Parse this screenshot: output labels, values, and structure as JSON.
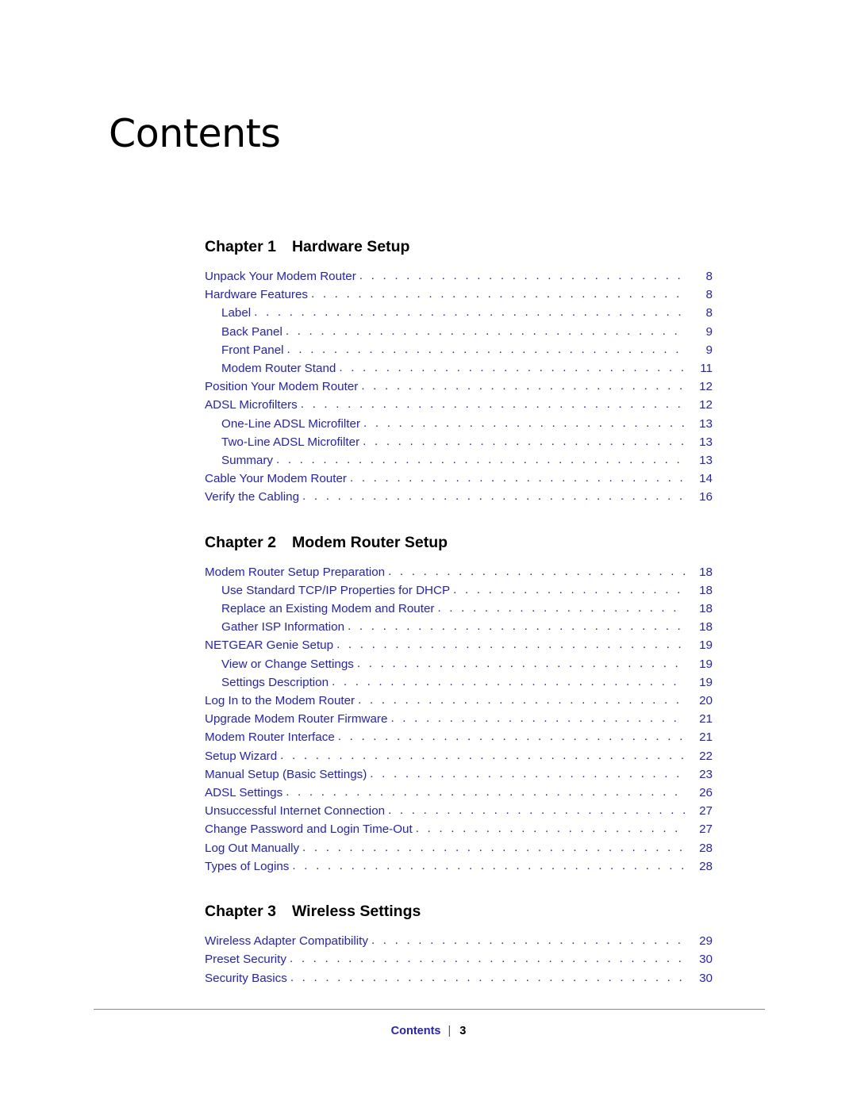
{
  "page": {
    "title": "Contents",
    "footer": {
      "title": "Contents",
      "separator": "|",
      "page_number": "3"
    }
  },
  "toc": {
    "groups": [
      {
        "chapter_label": "Chapter 1",
        "chapter_title": "Hardware Setup",
        "entries": [
          {
            "label": "Unpack Your Modem Router",
            "page": "8",
            "level": 1
          },
          {
            "label": "Hardware Features",
            "page": "8",
            "level": 1
          },
          {
            "label": "Label",
            "page": "8",
            "level": 2
          },
          {
            "label": "Back Panel",
            "page": "9",
            "level": 2
          },
          {
            "label": "Front Panel",
            "page": "9",
            "level": 2
          },
          {
            "label": "Modem Router Stand",
            "page": "11",
            "level": 2
          },
          {
            "label": "Position Your Modem Router",
            "page": "12",
            "level": 1
          },
          {
            "label": "ADSL Microfilters",
            "page": "12",
            "level": 1
          },
          {
            "label": "One-Line ADSL Microfilter",
            "page": "13",
            "level": 2
          },
          {
            "label": "Two-Line ADSL Microfilter",
            "page": "13",
            "level": 2
          },
          {
            "label": "Summary",
            "page": "13",
            "level": 2
          },
          {
            "label": "Cable Your Modem Router",
            "page": "14",
            "level": 1
          },
          {
            "label": "Verify the Cabling",
            "page": "16",
            "level": 1
          }
        ]
      },
      {
        "chapter_label": "Chapter 2",
        "chapter_title": "Modem Router Setup",
        "entries": [
          {
            "label": "Modem Router Setup Preparation",
            "page": "18",
            "level": 1
          },
          {
            "label": "Use Standard TCP/IP Properties for DHCP",
            "page": "18",
            "level": 2
          },
          {
            "label": "Replace an Existing Modem and Router",
            "page": "18",
            "level": 2
          },
          {
            "label": "Gather ISP Information",
            "page": "18",
            "level": 2
          },
          {
            "label": "NETGEAR Genie Setup",
            "page": "19",
            "level": 1
          },
          {
            "label": "View or Change Settings",
            "page": "19",
            "level": 2
          },
          {
            "label": "Settings Description",
            "page": "19",
            "level": 2
          },
          {
            "label": "Log In to the Modem Router",
            "page": "20",
            "level": 1
          },
          {
            "label": "Upgrade Modem Router Firmware",
            "page": "21",
            "level": 1
          },
          {
            "label": "Modem Router Interface",
            "page": "21",
            "level": 1
          },
          {
            "label": "Setup Wizard",
            "page": "22",
            "level": 1
          },
          {
            "label": "Manual Setup (Basic Settings)",
            "page": "23",
            "level": 1
          },
          {
            "label": "ADSL Settings",
            "page": "26",
            "level": 1
          },
          {
            "label": "Unsuccessful Internet Connection",
            "page": "27",
            "level": 1
          },
          {
            "label": "Change Password and Login Time-Out",
            "page": "27",
            "level": 1
          },
          {
            "label": "Log Out Manually",
            "page": "28",
            "level": 1
          },
          {
            "label": "Types of Logins",
            "page": "28",
            "level": 1
          }
        ]
      },
      {
        "chapter_label": "Chapter 3",
        "chapter_title": "Wireless Settings",
        "entries": [
          {
            "label": "Wireless Adapter Compatibility",
            "page": "29",
            "level": 1
          },
          {
            "label": "Preset Security",
            "page": "30",
            "level": 1
          },
          {
            "label": "Security Basics",
            "page": "30",
            "level": 1
          }
        ]
      }
    ]
  },
  "colors": {
    "link": "#2222cc",
    "text": "#000000",
    "rule": "#888888"
  }
}
